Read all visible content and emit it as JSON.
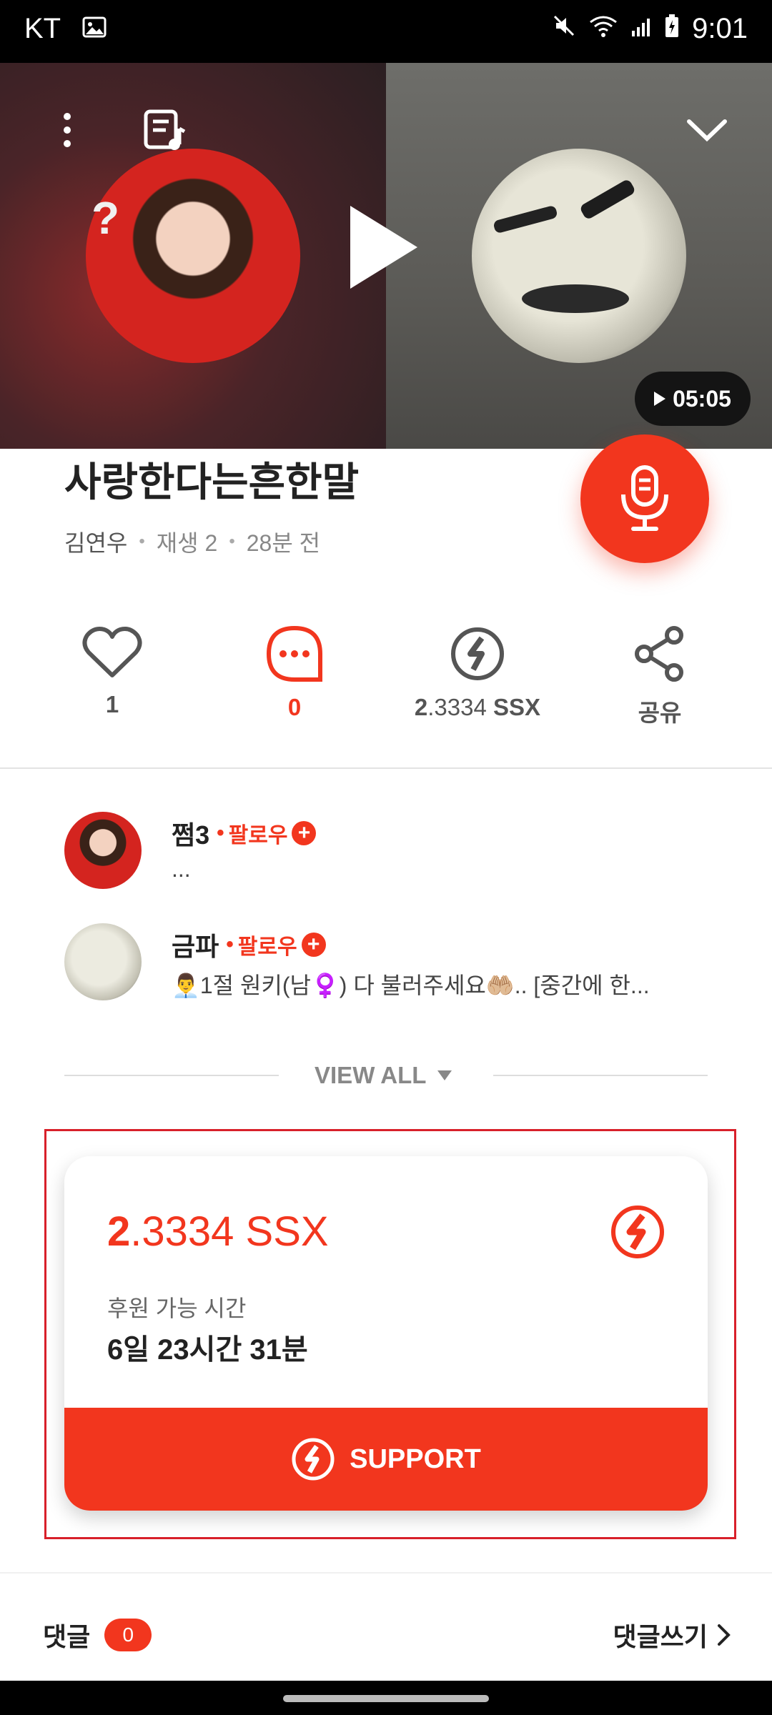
{
  "status_bar": {
    "carrier": "KT",
    "time": "9:01"
  },
  "player": {
    "duration": "05:05"
  },
  "song": {
    "title": "사랑한다는흔한말",
    "artist": "김연우",
    "plays": "재생 2",
    "posted": "28분 전"
  },
  "actions": {
    "likes": "1",
    "comments": "0",
    "support_amount_int": "2",
    "support_amount_dec": ".3334",
    "support_unit": "SSX",
    "share": "공유"
  },
  "participants": [
    {
      "name": "쩜3",
      "follow_label": "팔로우",
      "desc": "..."
    },
    {
      "name": "금파",
      "follow_label": "팔로우",
      "desc": "👨‍💼1절 원키(남♀️) 다 불러주세요🤲🏼.. [중간에 한..."
    }
  ],
  "view_all": "VIEW ALL",
  "support_card": {
    "amount_int": "2",
    "amount_dec": ".3334",
    "unit": "SSX",
    "time_label": "후원 가능 시간",
    "time_value": "6일 23시간 31분",
    "button_label": "SUPPORT"
  },
  "comments_bar": {
    "label": "댓글",
    "count": "0",
    "write": "댓글쓰기"
  },
  "colors": {
    "accent": "#f2361e",
    "highlight_border": "#d8202a"
  }
}
